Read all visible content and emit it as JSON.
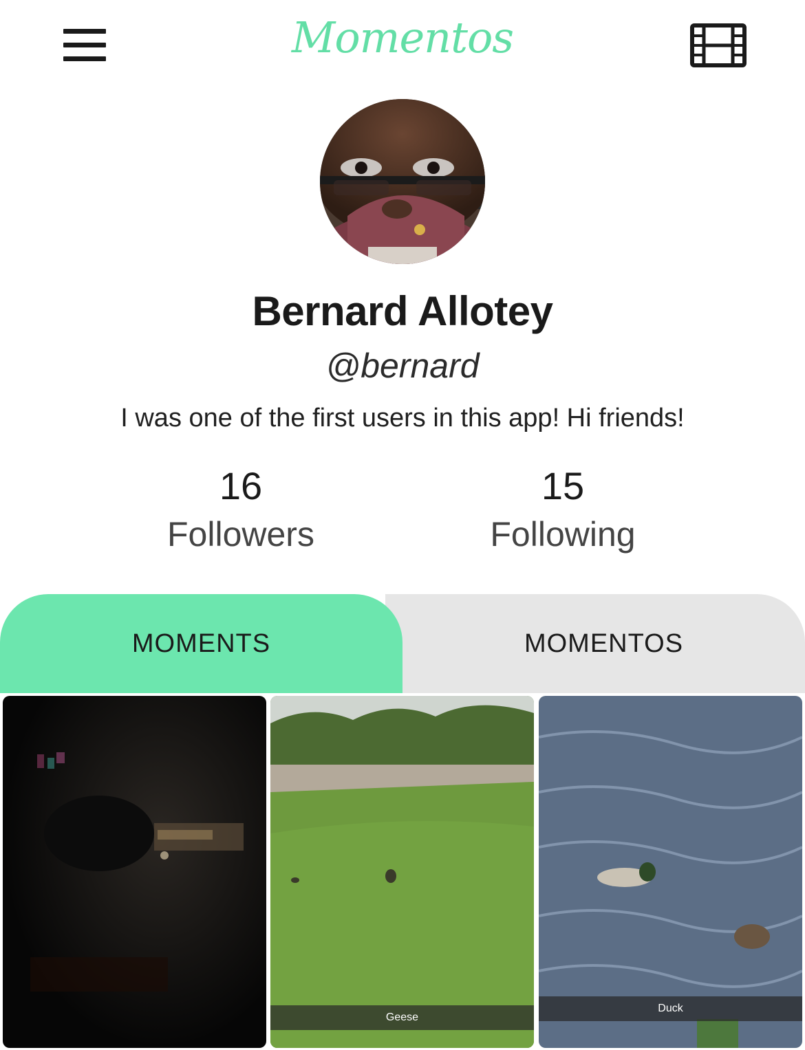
{
  "header": {
    "menu_icon": "hamburger-menu-icon",
    "app_title": "Momentos",
    "film_icon": "film-strip-icon",
    "accent_color": "#63dea6"
  },
  "profile": {
    "name": "Bernard Allotey",
    "handle": "@bernard",
    "bio": "I was one of the first users in this app! Hi friends!",
    "followers": {
      "count": "16",
      "label": "Followers"
    },
    "following": {
      "count": "15",
      "label": "Following"
    }
  },
  "tabs": [
    {
      "label": "MOMENTS",
      "active": true,
      "color": "#6ce6ae"
    },
    {
      "label": "MOMENTOS",
      "active": false,
      "color": "#e6e6e6"
    }
  ],
  "moments": [
    {
      "caption": ""
    },
    {
      "caption": "Geese"
    },
    {
      "caption": "Duck"
    }
  ]
}
